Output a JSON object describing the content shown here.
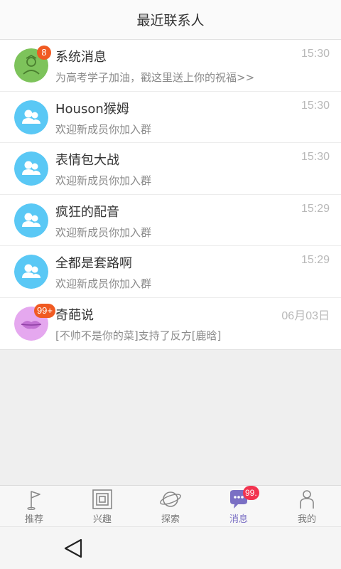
{
  "header": {
    "title": "最近联系人"
  },
  "contacts": [
    {
      "name": "系统消息",
      "time": "15:30",
      "message": "为高考学子加油，戳这里送上你的祝福>>",
      "badge": "8",
      "avatar": "system-avatar-icon"
    },
    {
      "name": "Houson猴姆",
      "time": "15:30",
      "message": "欢迎新成员你加入群",
      "badge": "",
      "avatar": "group-icon"
    },
    {
      "name": "表情包大战",
      "time": "15:30",
      "message": "欢迎新成员你加入群",
      "badge": "",
      "avatar": "group-icon"
    },
    {
      "name": "疯狂的配音",
      "time": "15:29",
      "message": "欢迎新成员你加入群",
      "badge": "",
      "avatar": "group-icon"
    },
    {
      "name": "全都是套路啊",
      "time": "15:29",
      "message": "欢迎新成员你加入群",
      "badge": "",
      "avatar": "group-icon"
    },
    {
      "name": "奇葩说",
      "time": "06月03日",
      "message": "[不帅不是你的菜]支持了反方[鹿晗]",
      "badge": "99+",
      "avatar": "lips-avatar-icon"
    }
  ],
  "tabs": [
    {
      "label": "推荐",
      "icon": "flag-icon",
      "active": false
    },
    {
      "label": "兴趣",
      "icon": "interest-square-icon",
      "active": false
    },
    {
      "label": "探索",
      "icon": "planet-icon",
      "active": false
    },
    {
      "label": "消息",
      "icon": "chat-bubble-icon",
      "active": true,
      "badge": "99."
    },
    {
      "label": "我的",
      "icon": "person-icon",
      "active": false
    }
  ],
  "colors": {
    "accent": "#7a6fc4",
    "badge": "#f05a22",
    "tab_badge": "#f2334f",
    "group_avatar": "#5ac8f5",
    "system_avatar": "#7dc35b",
    "lips_avatar": "#e5a8ef"
  }
}
